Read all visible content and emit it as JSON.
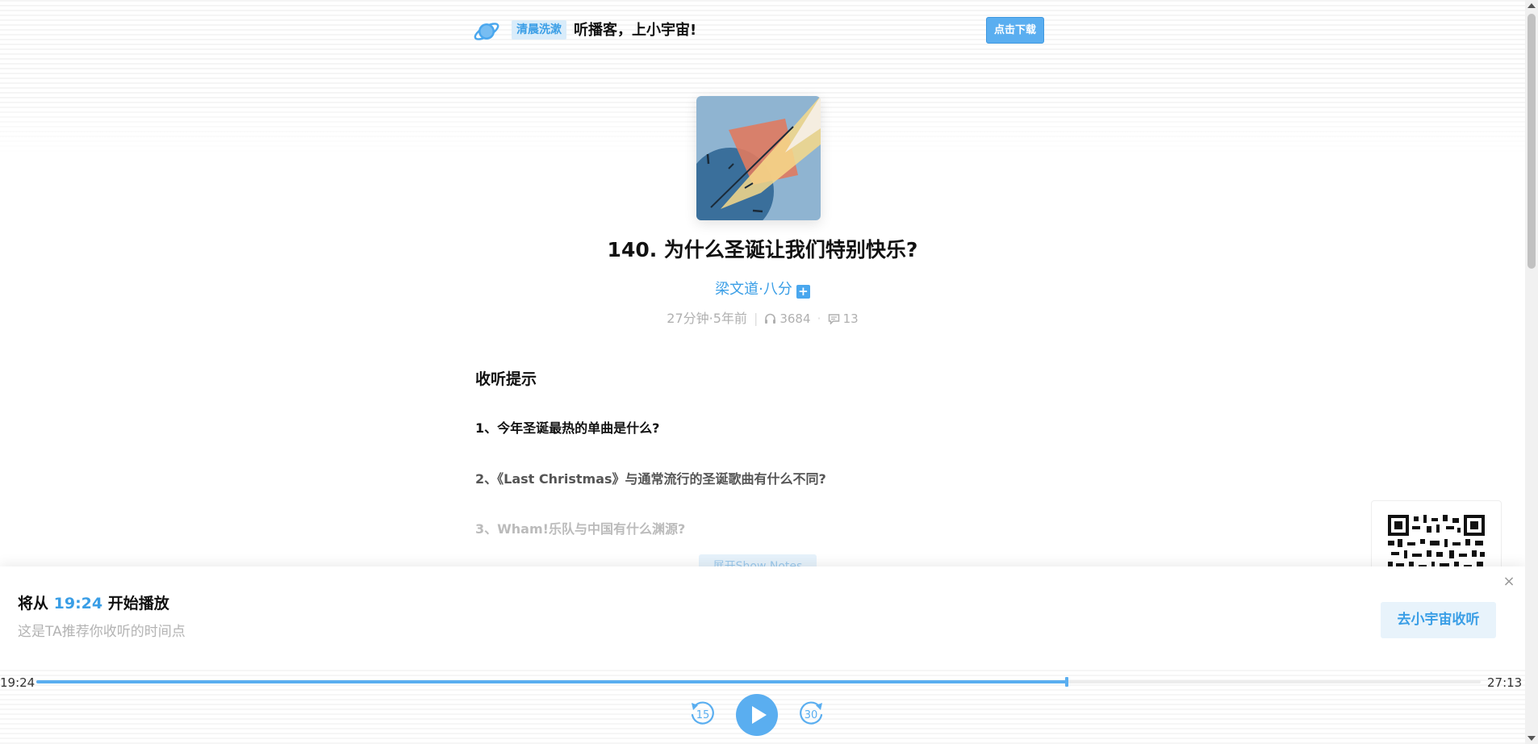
{
  "header": {
    "logo_icon": "planet-logo-icon",
    "tag": "清晨洗漱",
    "slogan": "听播客，上小宇宙!",
    "download_label": "点击下载"
  },
  "episode": {
    "cover_icon": "episode-cover-art",
    "title": "140. 为什么圣诞让我们特别快乐?",
    "author": "梁文道·八分",
    "follow_icon": "plus-icon",
    "duration_age": "27分钟·5年前",
    "plays": "3684",
    "comments": "13"
  },
  "shownotes": {
    "heading": "收听提示",
    "items": [
      "1、今年圣诞最热的单曲是什么?",
      "2、《Last Christmas》与通常流行的圣诞歌曲有什么不同?",
      "3、Wham!乐队与中国有什么渊源?"
    ],
    "expand_label": "展开Show Notes"
  },
  "player": {
    "start_prefix": "将从",
    "start_time": "19:24",
    "start_suffix": "开始播放",
    "start_sub": "这是TA推荐你收听的时间点",
    "listen_label": "去小宇宙收听",
    "current_time": "19:24",
    "total_time": "27:13",
    "progress": 0.7136,
    "rewind_seconds": "15",
    "forward_seconds": "30"
  },
  "colors": {
    "accent": "#3a9ee6",
    "accent_light": "#e8f3fb",
    "progress": "#5aaef0"
  }
}
